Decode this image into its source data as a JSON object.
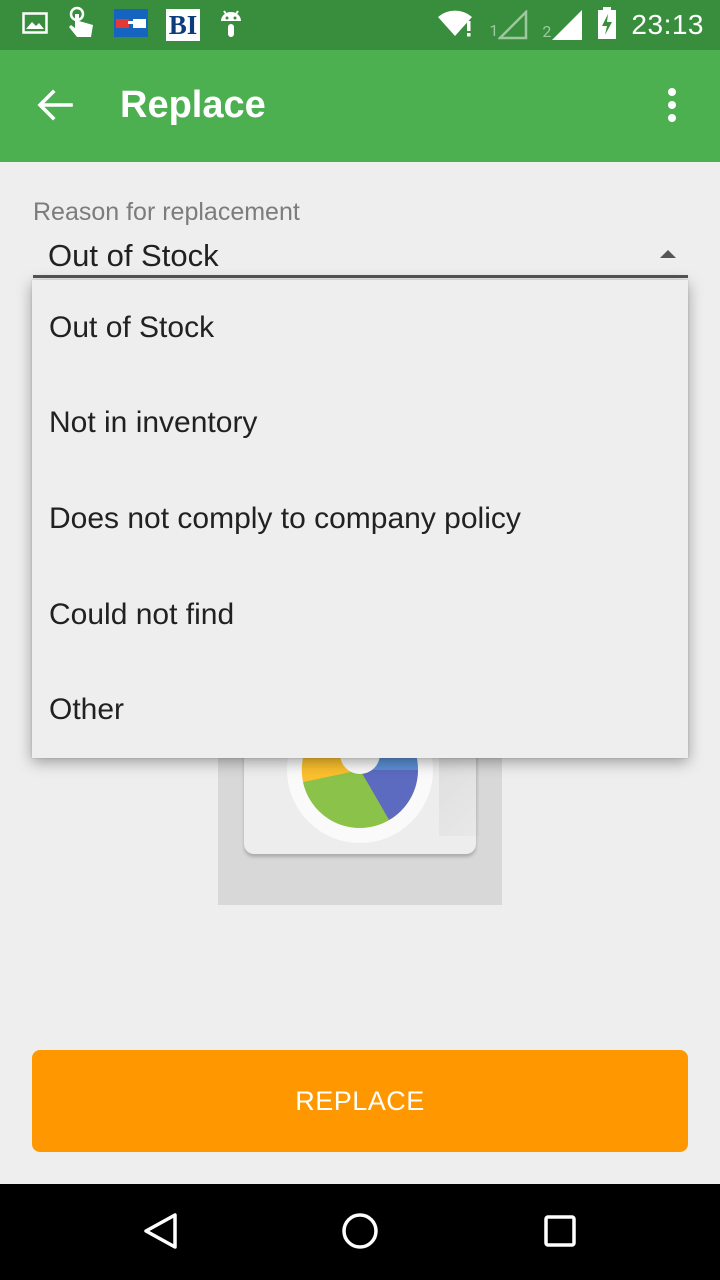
{
  "status_bar": {
    "time": "23:13",
    "sim1_label": "1",
    "sim2_label": "2",
    "left_icons": [
      "image-icon",
      "touch-icon",
      "glasses-app-icon",
      "bi-app-icon",
      "android-debug-icon"
    ],
    "bi_text": "BI"
  },
  "app_bar": {
    "title": "Replace",
    "back_icon": "arrow-back-icon",
    "menu_icon": "more-vert-icon",
    "color": "#4caf50"
  },
  "form": {
    "reason_label": "Reason for replacement",
    "reason_selected": "Out of Stock"
  },
  "dropdown": {
    "options": [
      {
        "label": "Out of Stock"
      },
      {
        "label": "Not in inventory"
      },
      {
        "label": "Does not comply to company policy"
      },
      {
        "label": "Could not find"
      },
      {
        "label": "Other"
      }
    ]
  },
  "actions": {
    "replace_label": "REPLACE",
    "replace_color": "#ff9800"
  },
  "nav_bar": {
    "back_icon": "nav-back-icon",
    "home_icon": "nav-home-icon",
    "recents_icon": "nav-recents-icon"
  }
}
